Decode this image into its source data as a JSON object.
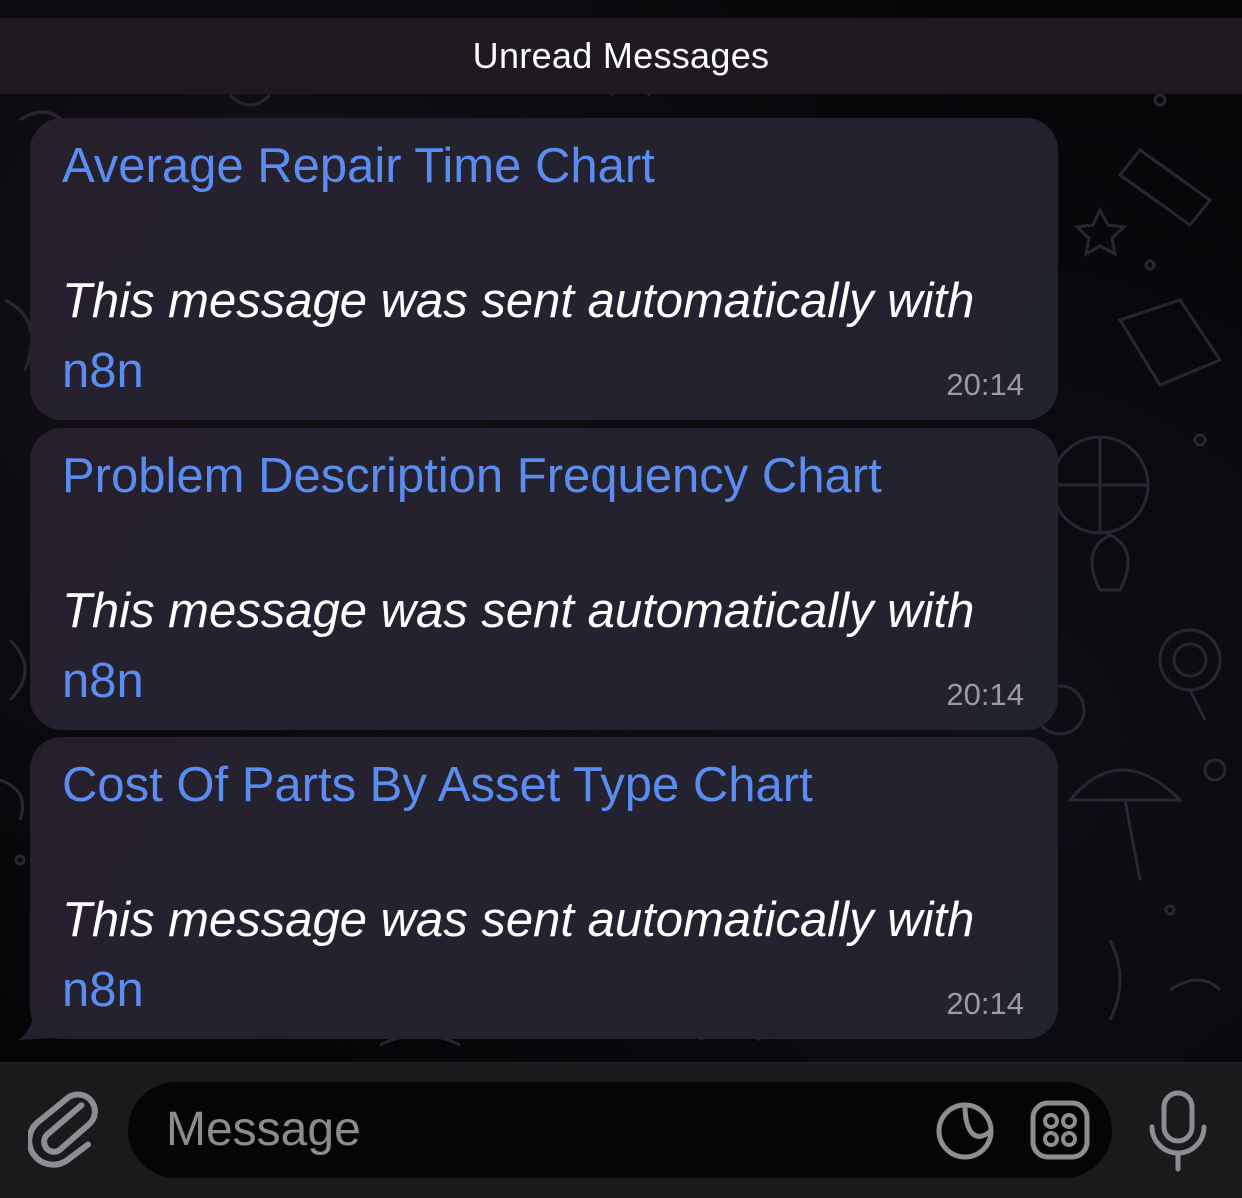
{
  "header": {
    "unread_label": "Unread Messages"
  },
  "messages": [
    {
      "title": "Average Repair Time Chart",
      "body": "This message was sent automatically with",
      "link": "n8n",
      "time": "20:14"
    },
    {
      "title": "Problem Description Frequency Chart",
      "body": "This message was sent automatically with",
      "link": "n8n",
      "time": "20:14"
    },
    {
      "title": "Cost Of Parts By Asset Type Chart",
      "body": "This message was sent automatically with",
      "link": "n8n",
      "time": "20:14"
    }
  ],
  "composer": {
    "placeholder": "Message",
    "icons": {
      "attach": "paperclip-icon",
      "sticker": "sticker-icon",
      "emoji_panel": "emoji-panel-icon",
      "voice": "microphone-icon"
    }
  },
  "colors": {
    "link": "#5b8cf0",
    "bubble": "#25212e",
    "timestamp": "#9d9aa5"
  }
}
